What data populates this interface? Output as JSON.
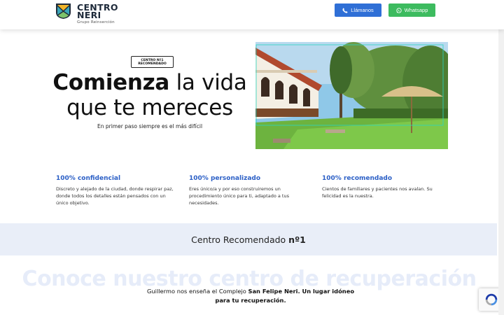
{
  "header": {
    "logo_name": "CENTRO NERI",
    "logo_sub": "Grupo Reinserción",
    "call_label": "Llámanos",
    "whatsapp_label": "Whatsapp"
  },
  "hero": {
    "badge_line1": "CENTRO Nº1",
    "badge_line2": "RECOMENDADO",
    "title_bold": "Comienza",
    "title_rest": "la vida",
    "title_line2": "que te mereces",
    "subtitle": "En primer paso siempre es el más difícil"
  },
  "features": [
    {
      "title": "100% confidencial",
      "text": "Discreto y alejado de la ciudad, donde respirar paz, donde todos los detalles están pensados con un único objetivo."
    },
    {
      "title": "100% personalizado",
      "text": "Eres único/a y por eso construiremos un procedimiento único para ti, adaptado a tus necesidades."
    },
    {
      "title": "100% recomendado",
      "text": "Cientos de familiares y pacientes nos avalan. Su felicidad es la nuestra."
    }
  ],
  "band": {
    "text": "Centro Recomendado",
    "text_bold": "nº1"
  },
  "video_section": {
    "ghost_heading": "Conoce nuestro centro de recuperación",
    "intro": "Guillermo nos enseña el Complejo",
    "bold": "San Felipe Neri. Un lugar idóneo para tu recuperación."
  },
  "colors": {
    "accent_blue": "#2b5fc6",
    "call_button": "#2f6fd6",
    "whatsapp_button": "#3dbb5f",
    "band_bg": "#e9eef8"
  }
}
